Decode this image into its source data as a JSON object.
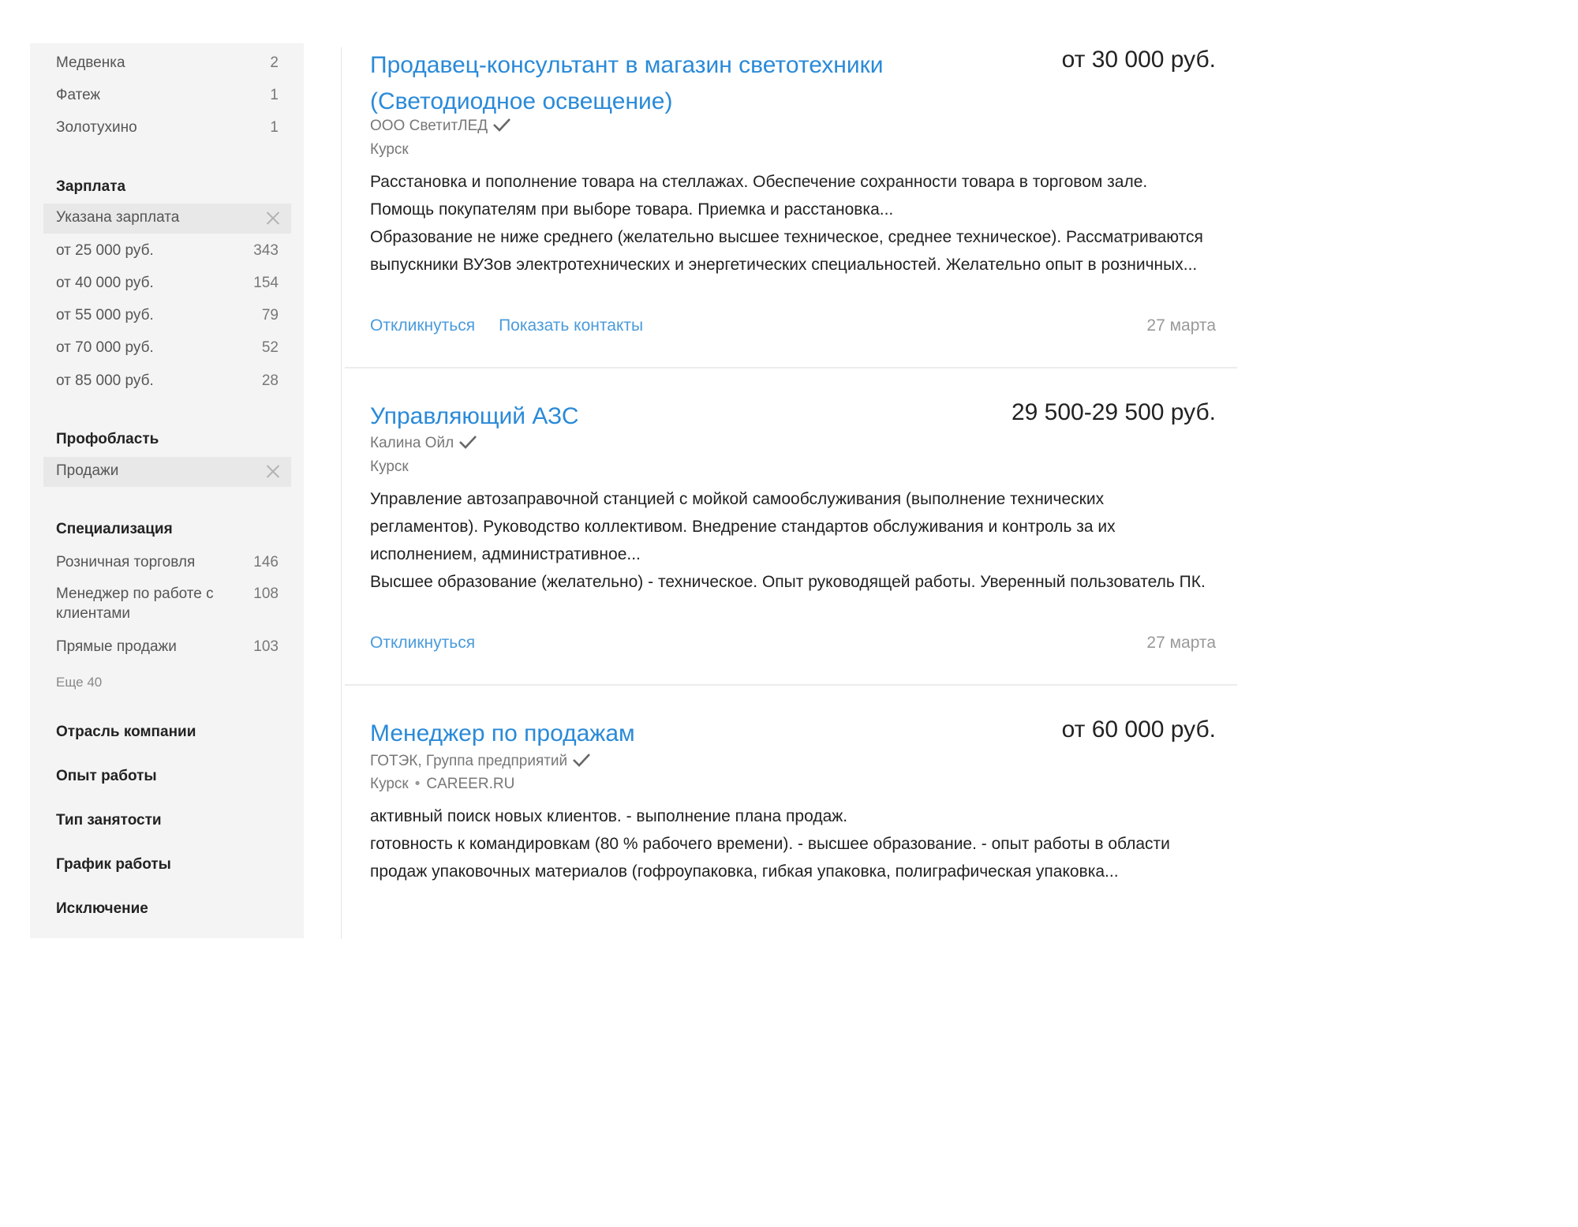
{
  "sidebar": {
    "region_items": [
      {
        "label": "Медвенка",
        "count": "2"
      },
      {
        "label": "Фатеж",
        "count": "1"
      },
      {
        "label": "Золотухино",
        "count": "1"
      }
    ],
    "salary": {
      "title": "Зарплата",
      "selected": "Указана зарплата",
      "items": [
        {
          "label": "от 25 000 руб.",
          "count": "343"
        },
        {
          "label": "от 40 000 руб.",
          "count": "154"
        },
        {
          "label": "от 55 000 руб.",
          "count": "79"
        },
        {
          "label": "от 70 000 руб.",
          "count": "52"
        },
        {
          "label": "от 85 000 руб.",
          "count": "28"
        }
      ]
    },
    "profarea": {
      "title": "Профобласть",
      "selected": "Продажи"
    },
    "specialization": {
      "title": "Специализация",
      "items": [
        {
          "label": "Розничная торговля",
          "count": "146"
        },
        {
          "label": "Менеджер по работе с клиентами",
          "count": "108"
        },
        {
          "label": "Прямые продажи",
          "count": "103"
        }
      ],
      "more": "Еще 40"
    },
    "sections": [
      "Отрасль компании",
      "Опыт работы",
      "Тип занятости",
      "График работы",
      "Исключение"
    ]
  },
  "vacancies": [
    {
      "title": "Продавец-консультант в магазин светотехники (Светодиодное освещение)",
      "salary": "от 30 000 руб.",
      "company": "ООО СветитЛЕД",
      "city": "Курск",
      "source": "",
      "responsibility": "Расстановка и пополнение товара на стеллажах. Обеспечение сохранности товара в торговом зале. Помощь покупателям при выборе товара. Приемка и расстановка...",
      "requirement": "Образование не ниже среднего (желательно высшее техническое, среднее техническое). Рассматриваются выпускники ВУЗов электротехнических и энергетических специальностей. Желательно опыт в розничных...",
      "respond": "Откликнуться",
      "contacts": "Показать контакты",
      "date": "27 марта"
    },
    {
      "title": "Управляющий АЗС",
      "salary": "29 500-29 500 руб.",
      "company": "Калина Ойл",
      "city": "Курск",
      "source": "",
      "responsibility": "Управление автозаправочной станцией с мойкой самообслуживания (выполнение технических регламентов). Руководство коллективом. Внедрение стандартов обслуживания и контроль за их исполнением, административное...",
      "requirement": "Высшее образование (желательно) - техническое. Опыт руководящей работы. Уверенный пользователь ПК.",
      "respond": "Откликнуться",
      "contacts": "",
      "date": "27 марта"
    },
    {
      "title": "Менеджер по продажам",
      "salary": "от 60 000 руб.",
      "company": "ГОТЭК, Группа предприятий",
      "city": "Курск",
      "source": "CAREER.RU",
      "source_separator": "•",
      "responsibility": "активный поиск новых клиентов. - выполнение плана продаж.",
      "requirement": "готовность к командировкам (80 % рабочего времени). - высшее образование. - опыт работы в области продаж упаковочных материалов (гофроупаковка, гибкая упаковка, полиграфическая упаковка...",
      "respond": "",
      "contacts": "",
      "date": ""
    }
  ],
  "colors": {
    "link": "#2a8ad8",
    "action": "#4a9bdb",
    "sidebar_bg": "#f4f4f4",
    "selected_bg": "#e8e8e8",
    "check": "#666666"
  }
}
